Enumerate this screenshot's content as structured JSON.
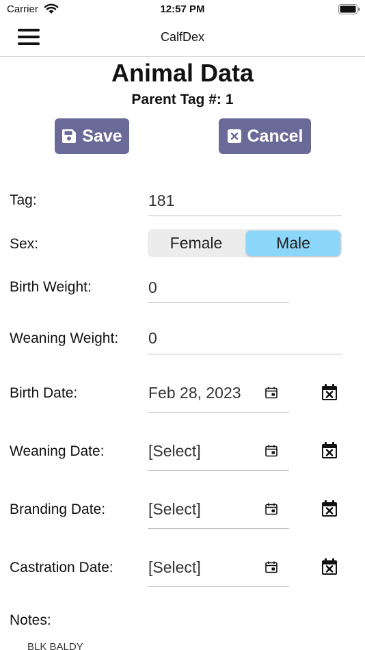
{
  "status": {
    "carrier": "Carrier",
    "time": "12:57 PM"
  },
  "nav": {
    "title": "CalfDex"
  },
  "header": {
    "title": "Animal Data",
    "parent_tag_label": "Parent Tag #:",
    "parent_tag_value": "1"
  },
  "actions": {
    "save_label": "Save",
    "cancel_label": "Cancel"
  },
  "form": {
    "tag": {
      "label": "Tag:",
      "value": "181"
    },
    "sex": {
      "label": "Sex:",
      "options": [
        "Female",
        "Male"
      ],
      "selected": "Male"
    },
    "birth_weight": {
      "label": "Birth Weight:",
      "value": "0"
    },
    "weaning_weight": {
      "label": "Weaning Weight:",
      "value": "0"
    },
    "birth_date": {
      "label": "Birth Date:",
      "value": "Feb 28, 2023"
    },
    "weaning_date": {
      "label": "Weaning Date:",
      "value": "[Select]"
    },
    "branding_date": {
      "label": "Branding Date:",
      "value": "[Select]"
    },
    "castration_date": {
      "label": "Castration Date:",
      "value": "[Select]"
    },
    "notes": {
      "label": "Notes:",
      "value": "BLK BALDY"
    }
  },
  "colors": {
    "button": "#6a6a98",
    "segment_active": "#8cd6f9"
  }
}
